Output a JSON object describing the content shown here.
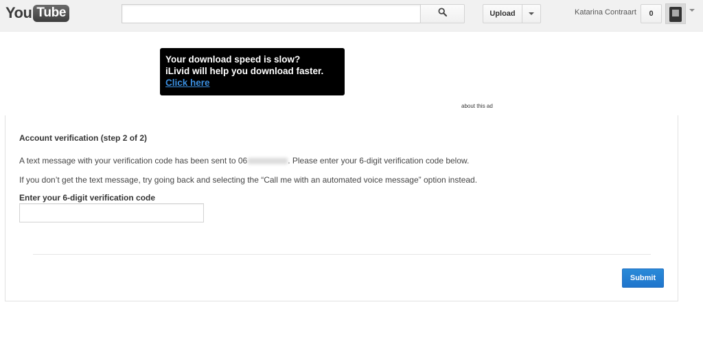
{
  "masthead": {
    "logo": {
      "you": "You",
      "tube": "Tube"
    },
    "search": {
      "placeholder": "",
      "button_icon": "search-icon"
    },
    "upload_label": "Upload",
    "username": "Katarina Contraart",
    "notification_count": "0"
  },
  "ad": {
    "line1": "Your download speed is slow?",
    "line2": "iLivid will help you download faster.",
    "link": "Click here",
    "about": "about this ad"
  },
  "verification": {
    "title": "Account verification (step 2 of 2)",
    "message_prefix": "A text message with your verification code has been sent to 06",
    "message_suffix": ". Please enter your 6-digit verification code below.",
    "help_text": "If you don’t get the text message, try going back and selecting the “Call me with an automated voice message” option instead.",
    "field_label": "Enter your 6-digit verification code",
    "field_value": "",
    "submit_label": "Submit"
  },
  "colors": {
    "masthead_bg": "#f1f1f1",
    "ad_bg": "#000000",
    "ad_link": "#3b8fe0",
    "submit_bg": "#2080d0"
  }
}
